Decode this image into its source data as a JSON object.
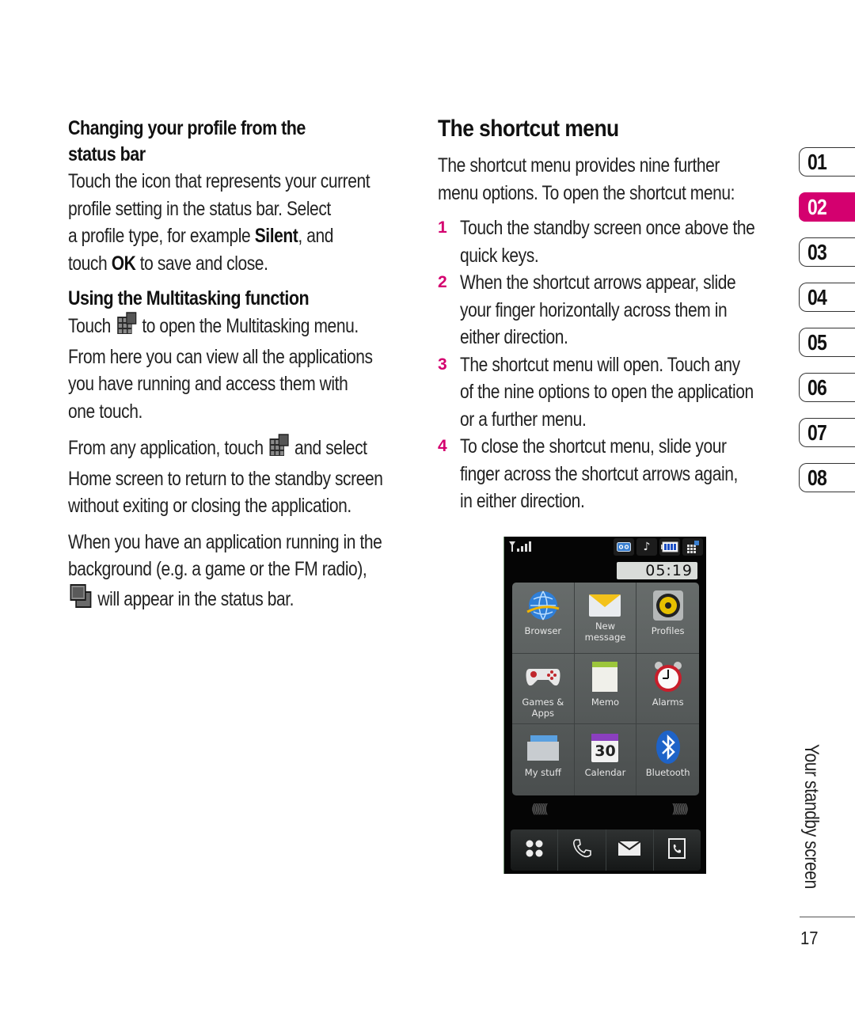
{
  "left_column": {
    "section1": {
      "heading_line1": "Changing your profile from the",
      "heading_line2": "status bar",
      "lines": [
        "Touch the icon that represents your current",
        "profile setting in the status bar. Select"
      ],
      "line3_pre": "a profile type, for example ",
      "line3_bold": "Silent",
      "line3_post": ", and",
      "line4_pre": "touch ",
      "line4_bold": "OK",
      "line4_post": " to save and close."
    },
    "section2": {
      "heading": "Using the Multitasking function",
      "para1_line1_pre": "Touch",
      "para1_line1_post": "to open the Multitasking menu.",
      "para1_lines": [
        "From here you can view all the applications",
        "you have running and access them with",
        "one touch."
      ],
      "para2_line1_pre": "From any application, touch",
      "para2_line1_post": "and select",
      "para2_lines": [
        "Home screen to return to the standby screen",
        "without exiting or closing the application."
      ],
      "para3_lines": [
        "When you have an application running in the",
        "background (e.g. a game or the FM radio),"
      ],
      "para3_last": "will appear in the status bar."
    }
  },
  "middle_column": {
    "heading": "The shortcut menu",
    "intro_lines": [
      "The shortcut menu provides nine further",
      "menu options. To open the shortcut menu:"
    ],
    "steps": [
      {
        "num": "1",
        "lines": [
          "Touch the standby screen once above the",
          "quick keys."
        ]
      },
      {
        "num": "2",
        "lines": [
          "When the shortcut arrows appear, slide",
          "your finger horizontally across them in",
          "either direction."
        ]
      },
      {
        "num": "3",
        "lines": [
          "The shortcut menu will open. Touch any",
          "of the nine options to open the application",
          "or a further menu."
        ]
      },
      {
        "num": "4",
        "lines": [
          "To close the shortcut menu, slide your",
          "finger across the shortcut arrows again,",
          "in either direction."
        ]
      }
    ]
  },
  "phone_screen": {
    "clock": "05:19",
    "status_icons": [
      "voicemail-icon",
      "music-note-icon",
      "battery-icon",
      "multitask-icon"
    ],
    "shortcuts": [
      {
        "label": "Browser",
        "icon": "globe-icon"
      },
      {
        "label": "New message",
        "icon": "envelope-icon"
      },
      {
        "label": "Profiles",
        "icon": "speaker-icon"
      },
      {
        "label": "Games & Apps",
        "icon": "gamepad-icon"
      },
      {
        "label": "Memo",
        "icon": "notepad-icon"
      },
      {
        "label": "Alarms",
        "icon": "alarm-clock-icon"
      },
      {
        "label": "My stuff",
        "icon": "folder-icon"
      },
      {
        "label": "Calendar",
        "icon": "calendar-icon",
        "badge": "30"
      },
      {
        "label": "Bluetooth",
        "icon": "bluetooth-icon"
      }
    ],
    "arrows_left": "((((((((",
    "arrows_right": "))))))))",
    "quick_keys": [
      "menu-dots-icon",
      "phone-icon",
      "message-icon",
      "contacts-icon"
    ]
  },
  "chapter_tabs": {
    "items": [
      "01",
      "02",
      "03",
      "04",
      "05",
      "06",
      "07",
      "08"
    ],
    "active": "02",
    "active_color": "#d4006f"
  },
  "footer": {
    "section_title": "Your standby screen",
    "page_number": "17"
  }
}
